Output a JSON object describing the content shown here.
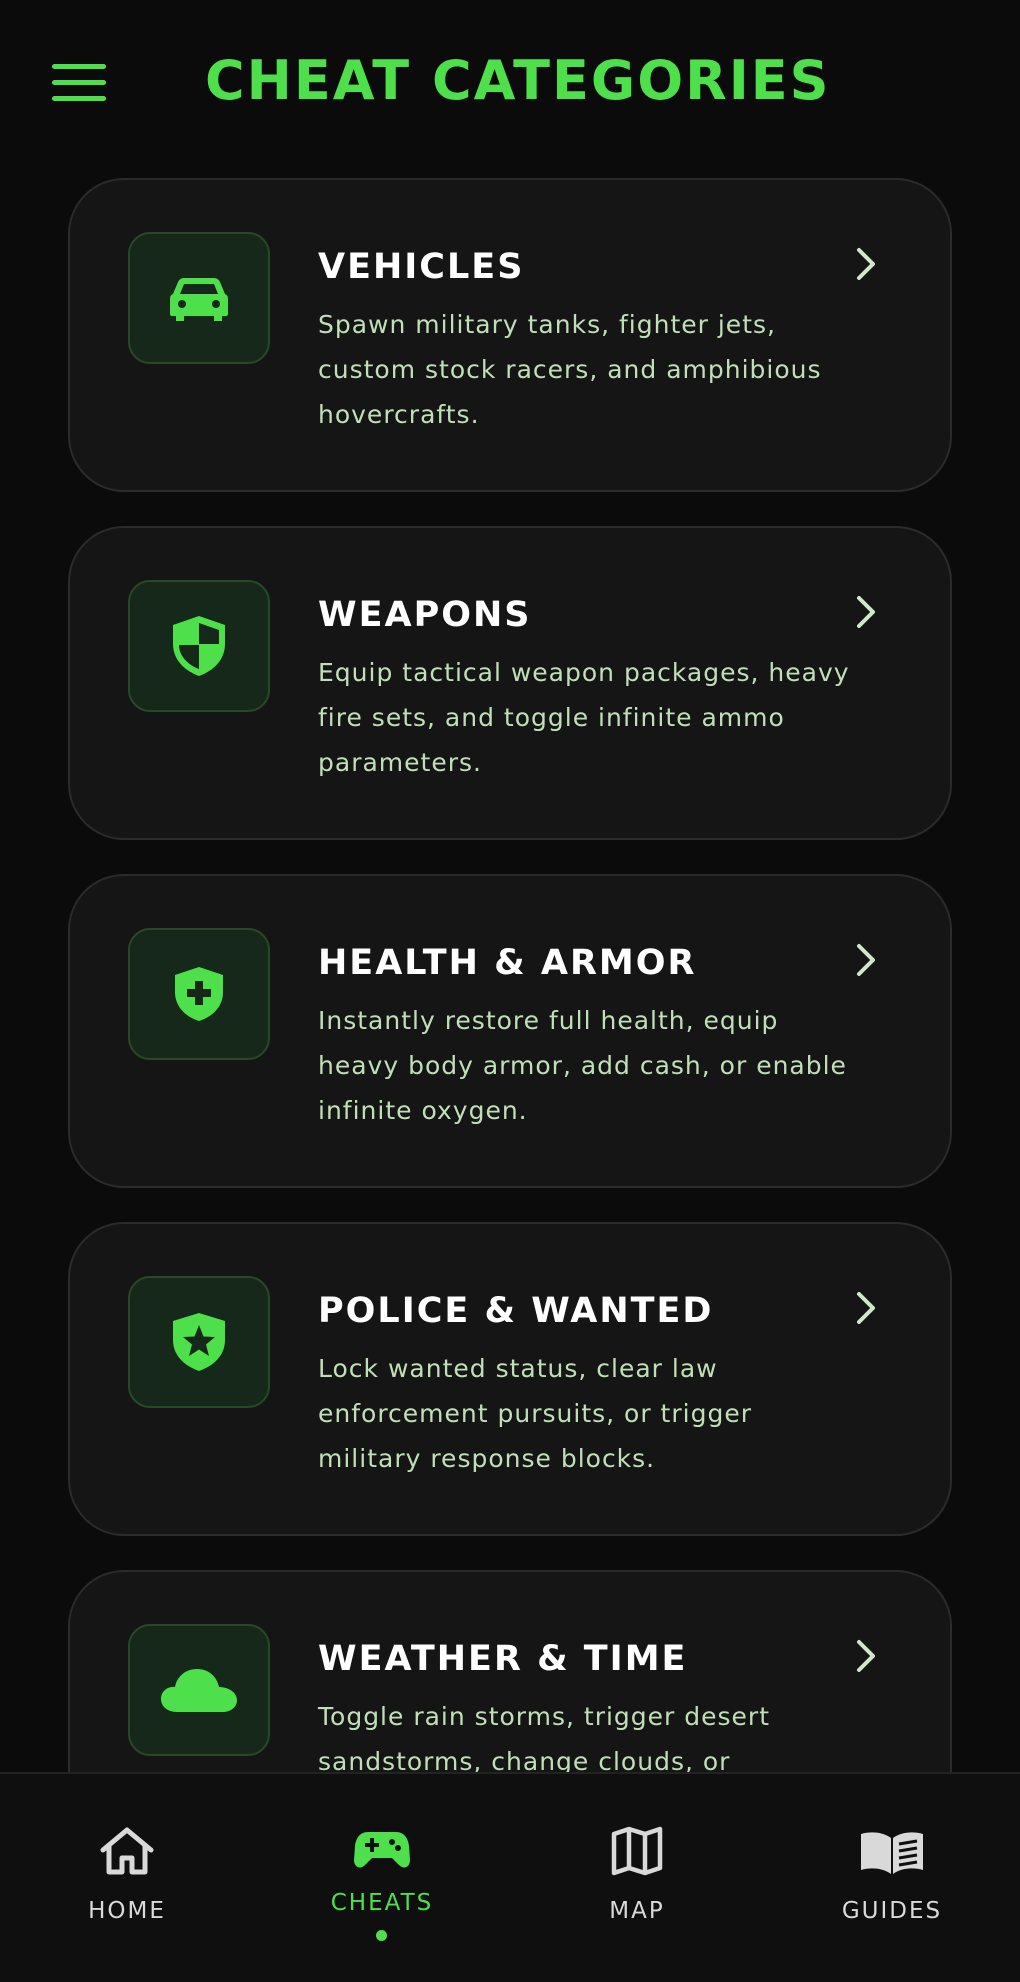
{
  "header": {
    "title": "CHEAT CATEGORIES"
  },
  "categories": [
    {
      "title": "VEHICLES",
      "description": "Spawn military tanks, fighter jets, custom stock racers, and amphibious hovercrafts.",
      "icon": "car-icon"
    },
    {
      "title": "WEAPONS",
      "description": "Equip tactical weapon packages, heavy fire sets, and toggle infinite ammo parameters.",
      "icon": "shield-half-icon"
    },
    {
      "title": "HEALTH & ARMOR",
      "description": "Instantly restore full health, equip heavy body armor, add cash, or enable infinite oxygen.",
      "icon": "shield-plus-icon"
    },
    {
      "title": "POLICE & WANTED",
      "description": "Lock wanted status, clear law enforcement pursuits, or trigger military response blocks.",
      "icon": "shield-star-icon"
    },
    {
      "title": "WEATHER & TIME",
      "description": "Toggle rain storms, trigger desert sandstorms, change clouds, or",
      "icon": "cloud-icon"
    }
  ],
  "nav": {
    "items": [
      {
        "label": "HOME",
        "icon": "home-icon",
        "active": false
      },
      {
        "label": "CHEATS",
        "icon": "gamepad-icon",
        "active": true
      },
      {
        "label": "MAP",
        "icon": "map-icon",
        "active": false
      },
      {
        "label": "GUIDES",
        "icon": "book-icon",
        "active": false
      }
    ]
  },
  "colors": {
    "accent": "#4ee04a",
    "background": "#0b0b0b",
    "card": "#151515",
    "card_border": "#2b2b2b",
    "icon_box": "#15281a",
    "title_text": "#ffffff",
    "description_text": "#bfe0b6",
    "nav_text": "#d9d9d9"
  }
}
